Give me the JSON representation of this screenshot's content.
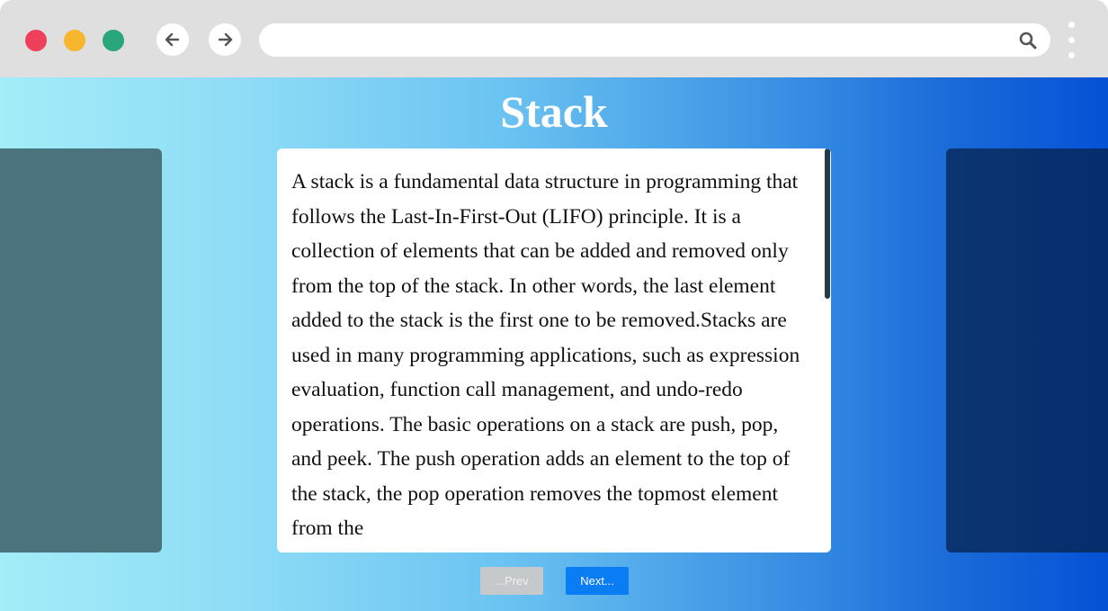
{
  "browser": {
    "dots": [
      {
        "name": "close",
        "color": "#ee3f5b"
      },
      {
        "name": "minimize",
        "color": "#f7b62b"
      },
      {
        "name": "maximize",
        "color": "#2aa67b"
      }
    ],
    "back_icon": "arrow-left-icon",
    "forward_icon": "arrow-right-icon",
    "url": "",
    "search_icon": "search-icon",
    "menu_icon": "kebab-menu-icon"
  },
  "page": {
    "title": "Stack",
    "content": "A stack is a fundamental data structure in programming that follows the Last-In-First-Out (LIFO) principle. It is a collection of elements that can be added and removed only from the top of the stack. In other words, the last element added to the stack is the first one to be removed.Stacks are used in many programming applications, such as expression evaluation, function call management, and undo-redo operations. The basic operations on a stack are push, pop, and peek. The push operation adds an element to the top of the stack, the pop operation removes the topmost element from the"
  },
  "controls": {
    "prev_label": "...Prev",
    "next_label": "Next...",
    "prev_disabled": true
  },
  "colors": {
    "next_button": "#0a7cf4",
    "prev_button_disabled": "#c5c9cc",
    "left_card": "#4b737e",
    "right_card": "#062c6c"
  }
}
